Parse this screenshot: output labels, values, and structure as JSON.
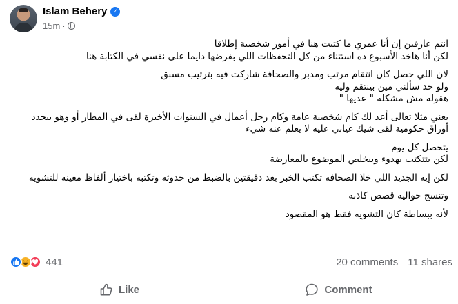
{
  "post": {
    "author": "Islam Behery",
    "time": "15m",
    "separator": "·",
    "paragraphs": [
      "انتم عارفين إن أنا عمري ما كتبت هنا في أمور شخصية إطلاقا\nلكن أنا هاخد الأسبوع ده استثناء من كل التحفظات اللي بفرضها دايما على نفسي في الكتابة هنا",
      "لان اللي حصل كان انتقام مرتب ومدبر والصحافة شاركت فيه بترتيب مسبق\nولو حد سألني مين بينتقم وليه\nهقوله مش مشكلة \" عديها \"",
      "يعني مثلا تعالى أعد لك كام شخصية عامة وكام رجل أعمال في السنوات الأخيرة لقى في المطار أو وهو بيجدد أوراق حكومية لقى شيك غيابي عليه لا يعلم عنه شيء",
      "يتحصل كل يوم\nلكن بتتكتب بهدوء وبيخلص الموضوع بالمعارضة",
      "لكن إيه الجديد اللي خلا الصحافة تكتب الخبر بعد دقيقتين بالضبط من حدوثه وتكتبه باختيار ألفاظ معينة للتشويه",
      "وتنسج حواليه قصص كاذبة",
      "لأنه ببساطة كان التشويه فقط هو المقصود"
    ]
  },
  "reactions": {
    "types": [
      "like-icon",
      "haha-icon",
      "love-icon"
    ],
    "count": "441"
  },
  "stats": {
    "comments": "20 comments",
    "shares": "11 shares"
  },
  "actions": {
    "like_label": "Like",
    "comment_label": "Comment"
  },
  "colors": {
    "accent": "#1877f2",
    "secondary_text": "#65676b",
    "love": "#f33e58",
    "haha": "#f7b125"
  }
}
